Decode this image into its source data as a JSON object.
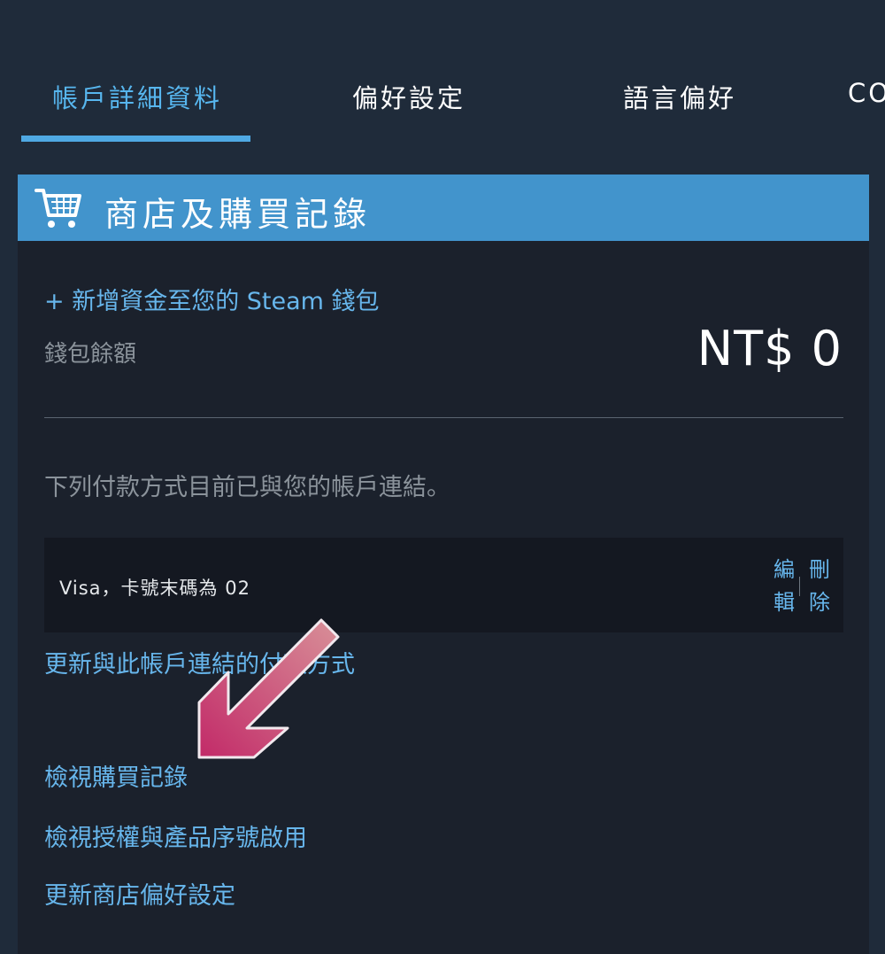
{
  "tabs": [
    {
      "label": "帳戶詳細資料",
      "active": true
    },
    {
      "label": "偏好設定",
      "active": false
    },
    {
      "label": "語言偏好",
      "active": false
    },
    {
      "label": "CO",
      "active": false
    }
  ],
  "section": {
    "title": "商店及購買記錄",
    "icon": "shopping-cart-icon"
  },
  "wallet": {
    "add_funds_link": "+ 新增資金至您的 Steam 錢包",
    "balance_label": "錢包餘額",
    "balance_value": "NT$ 0"
  },
  "payment": {
    "linked_text": "下列付款方式目前已與您的帳戶連結。",
    "method_text": "Visa，卡號末碼為 02",
    "edit_label": "編輯",
    "delete_label": "刪除"
  },
  "links": {
    "update_payment": "更新與此帳戶連結的付款方式",
    "purchase_history": "檢視購買記錄",
    "licenses": "檢視授權與產品序號啟用",
    "store_preferences": "更新商店偏好設定"
  },
  "annotation": {
    "icon": "pointer-arrow-icon",
    "color": "#c8306c"
  },
  "colors": {
    "background": "#1f2b3a",
    "panel": "#1b212c",
    "header": "#4294cc",
    "accent": "#67b6ec",
    "active_tab": "#57b6ee"
  }
}
